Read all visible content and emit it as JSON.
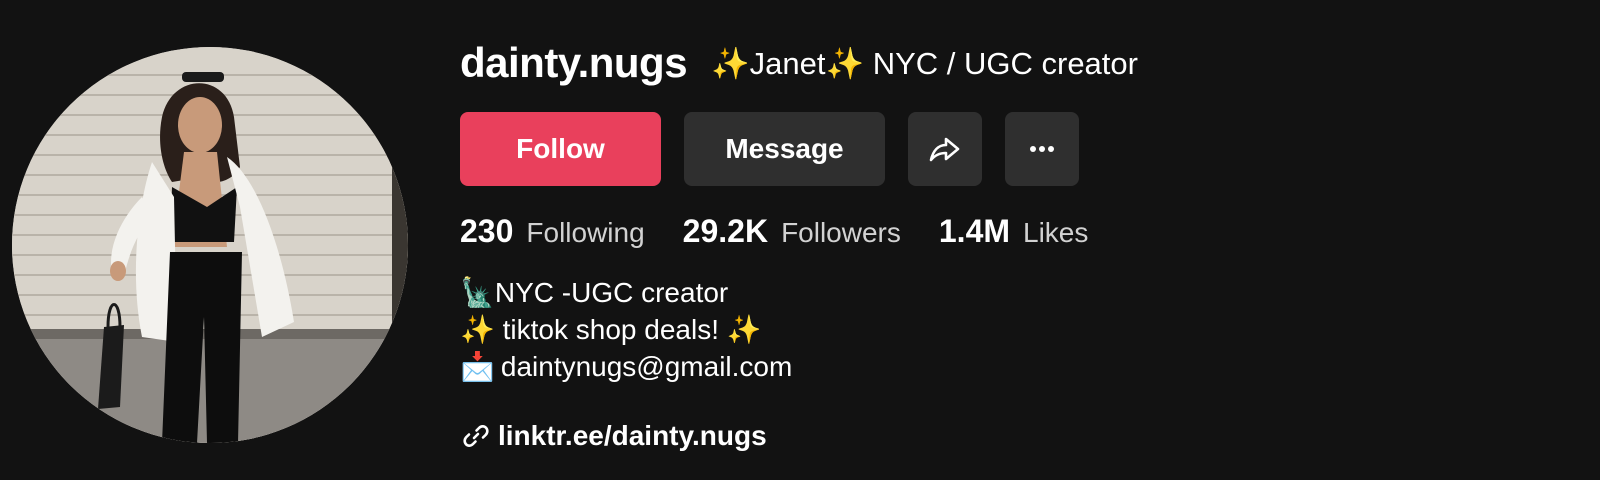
{
  "profile": {
    "username": "dainty.nugs",
    "display_name": "✨Janet✨ NYC / UGC creator",
    "avatar_icon": "profile-photo"
  },
  "actions": {
    "follow_label": "Follow",
    "message_label": "Message",
    "share_icon": "share-arrow-icon",
    "more_icon": "more-dots-icon"
  },
  "stats": [
    {
      "value": "230",
      "label": "Following"
    },
    {
      "value": "29.2K",
      "label": "Followers"
    },
    {
      "value": "1.4M",
      "label": "Likes"
    }
  ],
  "bio": {
    "line1_glyph": "🗽",
    "line1_text": "NYC -UGC creator",
    "line2_text": "✨ tiktok shop deals! ✨",
    "line3_glyph": "📩",
    "line3_text": "daintynugs@gmail.com"
  },
  "link": {
    "icon": "link-icon",
    "text": "linktr.ee/dainty.nugs"
  },
  "colors": {
    "background": "#121212",
    "follow_button": "#e9405c",
    "secondary_button": "#2f2f2f",
    "stat_label": "#d2d2d2"
  }
}
